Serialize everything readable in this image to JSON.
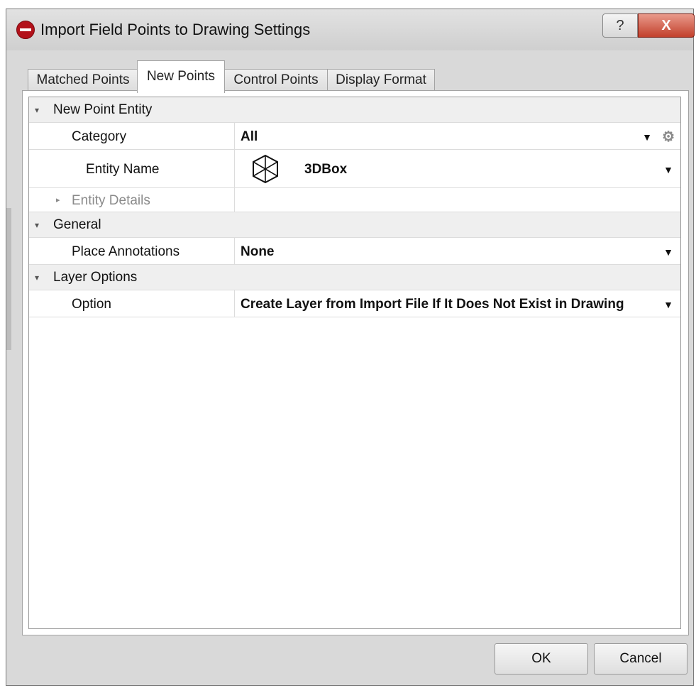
{
  "window": {
    "title": "Import Field Points to Drawing Settings",
    "help_label": "?",
    "close_label": "X"
  },
  "tabs": [
    {
      "label": "Matched Points",
      "active": false
    },
    {
      "label": "New Points",
      "active": true
    },
    {
      "label": "Control Points",
      "active": false
    },
    {
      "label": "Display Format",
      "active": false
    }
  ],
  "grid": {
    "new_point_entity": {
      "label": "New Point Entity",
      "category": {
        "name": "Category",
        "value": "All"
      },
      "entity_name": {
        "name": "Entity Name",
        "value": "3DBox"
      },
      "entity_details": {
        "name": "Entity Details"
      }
    },
    "general": {
      "label": "General",
      "place_annotations": {
        "name": "Place Annotations",
        "value": "None"
      }
    },
    "layer_options": {
      "label": "Layer Options",
      "option": {
        "name": "Option",
        "value": "Create Layer from Import File If It Does Not Exist in Drawing"
      }
    }
  },
  "buttons": {
    "ok": "OK",
    "cancel": "Cancel"
  },
  "icons": {
    "app_logo": "hilti-logo-icon",
    "gear": "gear-icon",
    "box": "3d-box-icon"
  },
  "colors": {
    "close_button": "#c2402c",
    "logo": "#b3121b"
  }
}
